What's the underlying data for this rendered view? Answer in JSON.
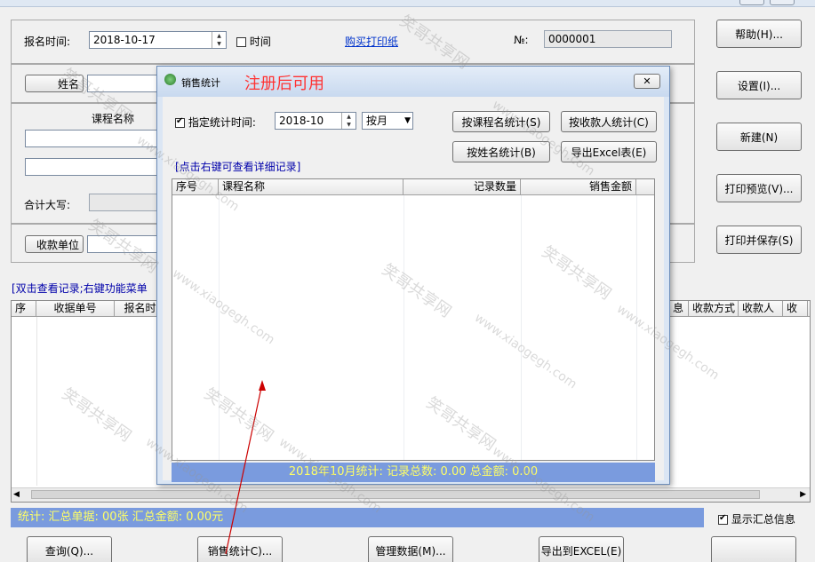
{
  "form": {
    "signup_time_label": "报名时间:",
    "signup_time_value": "2018-10-17",
    "time_checkbox_label": "时间",
    "buy_paper_link": "购买打印纸",
    "number_label": "№:",
    "number_value": "0000001",
    "name_button": "姓名",
    "course_name_header": "课程名称",
    "total_caps_label": "合计大写:",
    "payee_unit_button": "收款单位"
  },
  "side_buttons": {
    "help": "帮助(H)...",
    "settings": "设置(I)...",
    "new": "新建(N)",
    "print_preview": "打印预览(V)...",
    "print_save": "打印并保存(S)"
  },
  "records": {
    "hint": "[双击查看记录;右键功能菜单",
    "columns_left": [
      "序",
      "收据单号",
      "报名时间"
    ],
    "columns_right": [
      "息",
      "收款方式",
      "收款人",
      "收"
    ],
    "summary": "统计:  汇总单据: 00张     汇总金额: 0.00元",
    "show_summary_label": "显示汇总信息"
  },
  "bottom_buttons": {
    "query": "查询(Q)...",
    "sales_stats": "销售统计C)...",
    "manage_data": "管理数据(M)...",
    "export_excel": "导出到EXCEL(E)"
  },
  "dialog": {
    "title": "销售统计",
    "register_note": "注册后可用",
    "close_symbol": "✕",
    "specify_time_label": "指定统计时间:",
    "month_value": "2018-10",
    "mode_value": "按月",
    "by_course": "按课程名统计(S)",
    "by_payee": "按收款人统计(C)",
    "by_name": "按姓名统计(B)",
    "export_excel": "导出Excel表(E)",
    "hint": "[点击右键可查看详细记录]",
    "columns": [
      "序号",
      "课程名称",
      "记录数量",
      "销售金额"
    ],
    "footer": "2018年10月统计: 记录总数: 0.00      总金额: 0.00"
  },
  "watermark": {
    "text_cn": "笑哥共享网",
    "text_url": "www.xiaogegh.com"
  },
  "colors": {
    "status_bar_bg": "#7a9bde",
    "status_text": "#ffff66",
    "register_note": "#ff3333",
    "link": "#0033cc",
    "arrow": "#cc0000"
  }
}
